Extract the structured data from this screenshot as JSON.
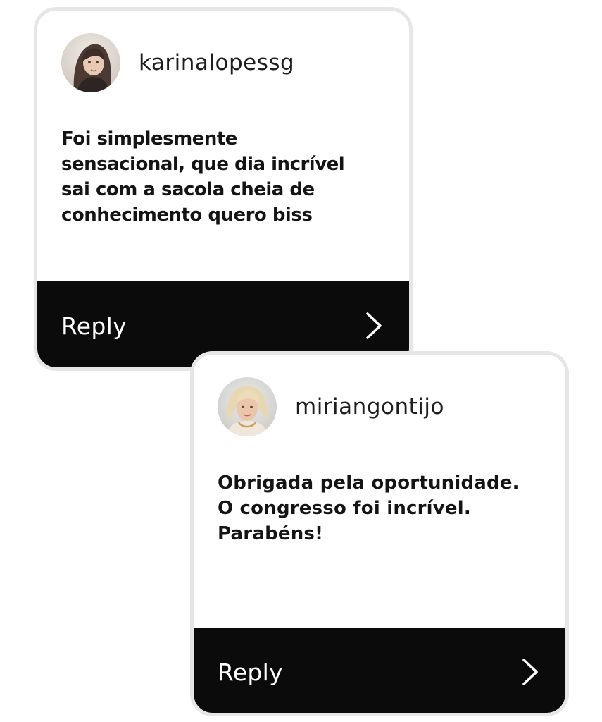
{
  "comments": [
    {
      "username": "karinalopessg",
      "avatar_icon": "user-avatar-photo",
      "text_lines": [
        "Foi simplesmente",
        "sensacional,  que dia incrível",
        "sai com a sacola cheia de",
        "conhecimento quero biss"
      ],
      "reply_label": "Reply",
      "reply_icon": "chevron-right-icon"
    },
    {
      "username": "miriangontijo",
      "avatar_icon": "user-avatar-photo",
      "text_lines": [
        "Obrigada pela oportunidade.",
        "O congresso foi incrível.",
        "Parabéns!"
      ],
      "reply_label": "Reply",
      "reply_icon": "chevron-right-icon"
    }
  ],
  "colors": {
    "card_border": "#e6e6e6",
    "reply_bar": "#0b0b0b",
    "reply_text": "#ffffff",
    "text": "#141414"
  }
}
